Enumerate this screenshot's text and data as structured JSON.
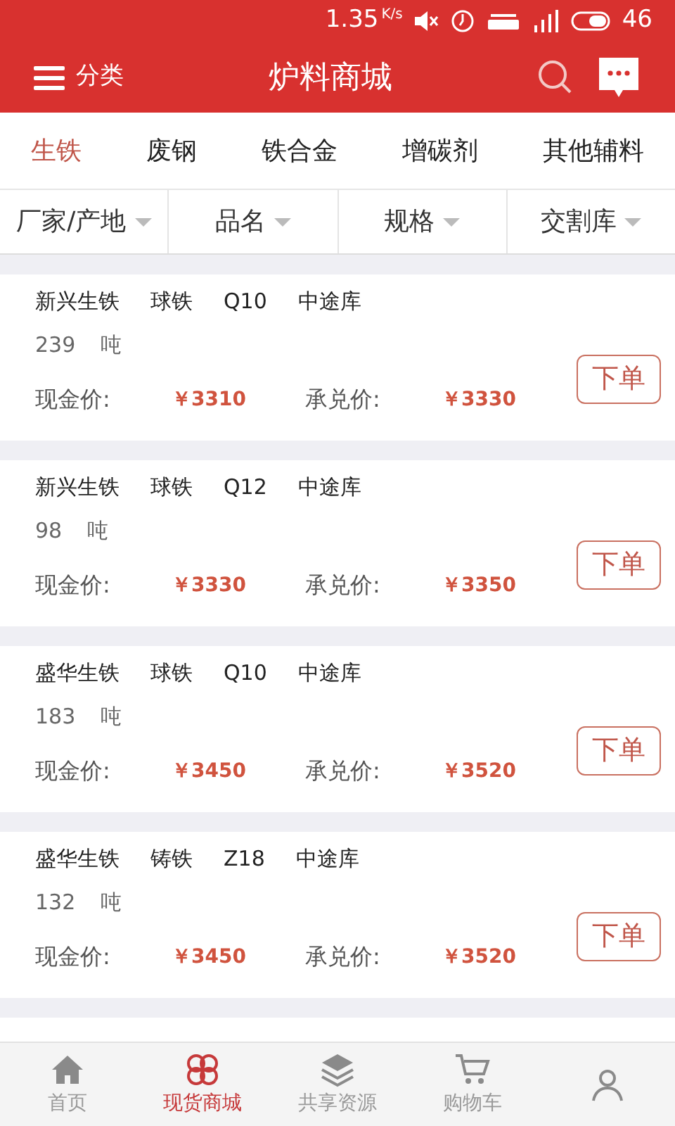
{
  "status_bar": {
    "speed": "1.35",
    "speed_unit": "K/s",
    "battery": "46"
  },
  "header": {
    "menu_label": "分类",
    "title": "炉料商城"
  },
  "tabs": [
    {
      "label": "生铁",
      "selected": true
    },
    {
      "label": "废钢",
      "selected": false
    },
    {
      "label": "铁合金",
      "selected": false
    },
    {
      "label": "增碳剂",
      "selected": false
    },
    {
      "label": "其他辅料",
      "selected": false
    }
  ],
  "filters": [
    "厂家/产地",
    "品名",
    "规格",
    "交割库"
  ],
  "products": [
    {
      "maker": "新兴生铁",
      "name": "球铁",
      "spec": "Q10",
      "depot": "中途库",
      "qty": "239",
      "unit": "吨",
      "cash_label": "现金价:",
      "cash": "￥3310",
      "accept_label": "承兑价:",
      "accept": "￥3330",
      "button": "下单"
    },
    {
      "maker": "新兴生铁",
      "name": "球铁",
      "spec": "Q12",
      "depot": "中途库",
      "qty": "98",
      "unit": "吨",
      "cash_label": "现金价:",
      "cash": "￥3330",
      "accept_label": "承兑价:",
      "accept": "￥3350",
      "button": "下单"
    },
    {
      "maker": "盛华生铁",
      "name": "球铁",
      "spec": "Q10",
      "depot": "中途库",
      "qty": "183",
      "unit": "吨",
      "cash_label": "现金价:",
      "cash": "￥3450",
      "accept_label": "承兑价:",
      "accept": "￥3520",
      "button": "下单"
    },
    {
      "maker": "盛华生铁",
      "name": "铸铁",
      "spec": "Z18",
      "depot": "中途库",
      "qty": "132",
      "unit": "吨",
      "cash_label": "现金价:",
      "cash": "￥3450",
      "accept_label": "承兑价:",
      "accept": "￥3520",
      "button": "下单"
    }
  ],
  "bottom_nav": [
    {
      "kind": "home",
      "label": "首页",
      "selected": false
    },
    {
      "kind": "clover",
      "label": "现货商城",
      "selected": true
    },
    {
      "kind": "layers",
      "label": "共享资源",
      "selected": false
    },
    {
      "kind": "cart",
      "label": "购物车",
      "selected": false
    },
    {
      "kind": "person",
      "selected": false
    }
  ]
}
